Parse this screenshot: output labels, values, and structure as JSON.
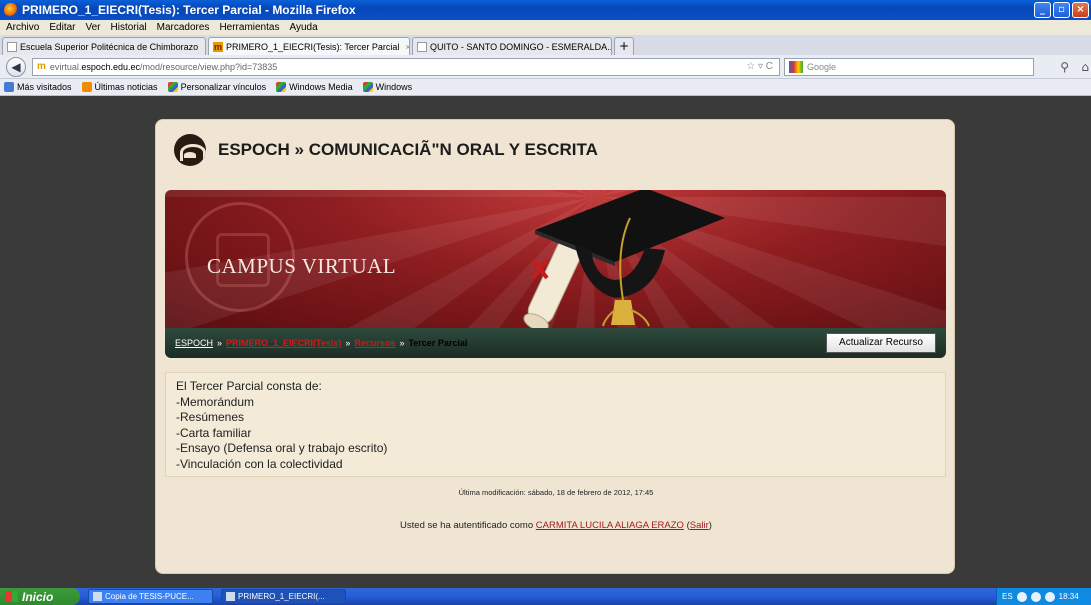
{
  "window": {
    "title": "PRIMERO_1_EIECRI(Tesis): Tercer Parcial - Mozilla Firefox"
  },
  "menu": [
    "Archivo",
    "Editar",
    "Ver",
    "Historial",
    "Marcadores",
    "Herramientas",
    "Ayuda"
  ],
  "tabs": [
    {
      "label": "Escuela Superior Politécnica de Chimborazo",
      "active": false
    },
    {
      "label": "PRIMERO_1_EIECRI(Tesis): Tercer Parcial",
      "active": true
    },
    {
      "label": "QUITO - SANTO DOMINGO - ESMERALDA...",
      "active": false
    }
  ],
  "nav": {
    "url_prefix": "evirtual.",
    "url_domain": "espoch.edu.ec",
    "url_path": "/mod/resource/view.php?id=73835",
    "search_placeholder": "Google"
  },
  "bookmarks": [
    "Más visitados",
    "Últimas noticias",
    "Personalizar vínculos",
    "Windows Media",
    "Windows"
  ],
  "page": {
    "site_title": "ESPOCH » COMUNICACIÃ\"N ORAL Y ESCRITA",
    "banner_text": "CAMPUS VIRTUAL",
    "breadcrumb": {
      "home": "ESPOCH",
      "course": "PRIMERO_1_EIECRI(Tesis)",
      "resources": "Recursos",
      "current": "Tercer Parcial",
      "sep": "»"
    },
    "update_button": "Actualizar Recurso",
    "content_lines": [
      "El Tercer Parcial consta de:",
      "-Memorándum",
      "-Resúmenes",
      "-Carta familiar",
      "-Ensayo (Defensa oral y  trabajo escrito)",
      "-Vinculación con la colectividad"
    ],
    "modified": "Última modificación: sábado, 18 de febrero de 2012, 17:45",
    "login_prefix": "Usted se ha autentificado como",
    "login_user": "CARMITA LUCILA ALIAGA ERAZO",
    "logout_label": "Salir"
  },
  "taskbar": {
    "start": "Inicio",
    "tasks": [
      "Copia de TESIS-PUCE...",
      "PRIMERO_1_EIECRI(..."
    ],
    "lang": "ES",
    "time": "18:34"
  },
  "colors": {
    "banner": "#8d1d20",
    "container": "#f0e5d2",
    "breadcrumb_link": "#d21a1a",
    "nav_strip": "#2f4a3d"
  }
}
